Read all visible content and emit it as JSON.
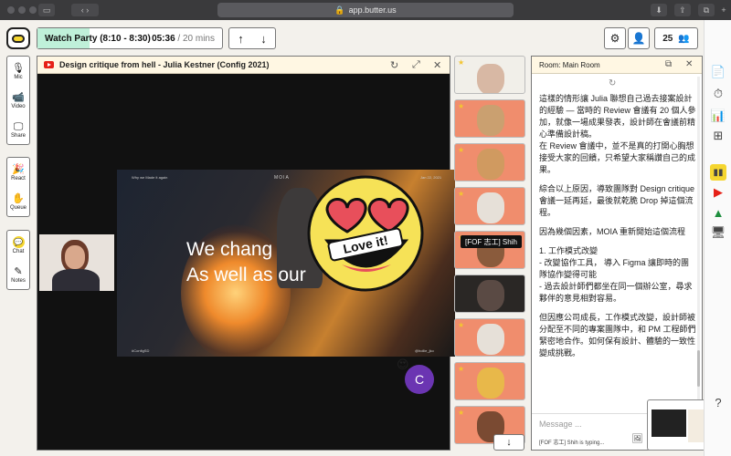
{
  "browser": {
    "url": "app.butter.us"
  },
  "topbar": {
    "agenda_title": "Watch Party (8:10 - 8:30)",
    "agenda_elapsed": "05:36",
    "agenda_total": "/ 20 mins",
    "agenda_progress": 0.28,
    "participant_count": "25"
  },
  "tools": {
    "mic": "Mic",
    "video": "Video",
    "share": "Share",
    "react": "React",
    "queue": "Queue",
    "chat": "Chat",
    "notes": "Notes"
  },
  "video": {
    "title": "Design critique from hell - Julia Kestner (Config 2021)",
    "slide_top_left": "Why we Made it again",
    "slide_brand": "MOIA",
    "slide_date": "Jan 22, 2021",
    "slide_line1": "We chang",
    "slide_line2": "As well as our",
    "slide_bottom_left": "#ConfigSD",
    "slide_bottom_right": "@hollie_jko",
    "reaction_text": "Love it!",
    "avatar_initial": "C"
  },
  "participants": {
    "name_tag": "[FOF 志工] Shih"
  },
  "chat": {
    "room_title": "Room: Main Room",
    "paragraphs": [
      "這樣的情形讓 Julia 聯想自己過去接案設計的經驗 — 當時的 Review 會議有 20 個人參加，就像一場成果發表，設計師在會議前精心準備設計稿。",
      "在 Review 會議中，並不是真的打開心胸想接受大家的回饋，只希望大家稱讚自己的成果。",
      "綜合以上原因，導致團隊對 Design critique 會議一延再延，最後就乾脆 Drop 掉這個流程。",
      "因為幾個因素，MOIA 重新開始這個流程",
      "1. 工作模式改變\n- 改變協作工具， 導入 Figma 讓即時的團隊協作變得可能\n- 過去設計師們都坐在同一個辦公室，尋求夥伴的意見相對容易。",
      "但因應公司成長，工作模式改變，設計師被分配至不同的專案團隊中，和 PM 工程師們緊密地合作。如何保有設計、體驗的一致性變成挑戰。"
    ],
    "placeholder": "Message ...",
    "typing": "[FOF 志工] Shih is typing..."
  },
  "colors": {
    "agenda_fill": "#bff0d9",
    "accent_yellow": "#f5d630",
    "avatar_purple": "#6b35b2",
    "header_cream": "#fff7e3"
  }
}
